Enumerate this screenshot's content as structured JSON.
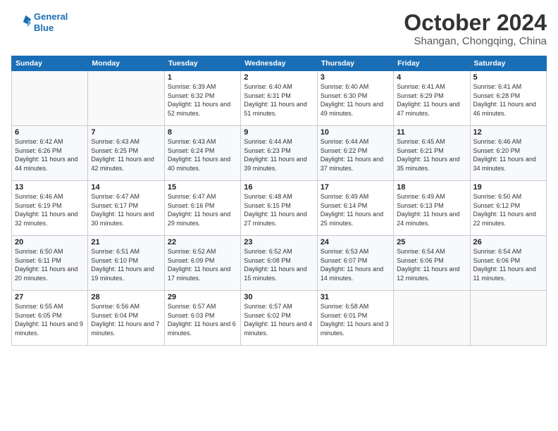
{
  "header": {
    "logo_line1": "General",
    "logo_line2": "Blue",
    "month": "October 2024",
    "location": "Shangan, Chongqing, China"
  },
  "weekdays": [
    "Sunday",
    "Monday",
    "Tuesday",
    "Wednesday",
    "Thursday",
    "Friday",
    "Saturday"
  ],
  "weeks": [
    [
      {
        "day": "",
        "sunrise": "",
        "sunset": "",
        "daylight": ""
      },
      {
        "day": "",
        "sunrise": "",
        "sunset": "",
        "daylight": ""
      },
      {
        "day": "1",
        "sunrise": "Sunrise: 6:39 AM",
        "sunset": "Sunset: 6:32 PM",
        "daylight": "Daylight: 11 hours and 52 minutes."
      },
      {
        "day": "2",
        "sunrise": "Sunrise: 6:40 AM",
        "sunset": "Sunset: 6:31 PM",
        "daylight": "Daylight: 11 hours and 51 minutes."
      },
      {
        "day": "3",
        "sunrise": "Sunrise: 6:40 AM",
        "sunset": "Sunset: 6:30 PM",
        "daylight": "Daylight: 11 hours and 49 minutes."
      },
      {
        "day": "4",
        "sunrise": "Sunrise: 6:41 AM",
        "sunset": "Sunset: 6:29 PM",
        "daylight": "Daylight: 11 hours and 47 minutes."
      },
      {
        "day": "5",
        "sunrise": "Sunrise: 6:41 AM",
        "sunset": "Sunset: 6:28 PM",
        "daylight": "Daylight: 11 hours and 46 minutes."
      }
    ],
    [
      {
        "day": "6",
        "sunrise": "Sunrise: 6:42 AM",
        "sunset": "Sunset: 6:26 PM",
        "daylight": "Daylight: 11 hours and 44 minutes."
      },
      {
        "day": "7",
        "sunrise": "Sunrise: 6:43 AM",
        "sunset": "Sunset: 6:25 PM",
        "daylight": "Daylight: 11 hours and 42 minutes."
      },
      {
        "day": "8",
        "sunrise": "Sunrise: 6:43 AM",
        "sunset": "Sunset: 6:24 PM",
        "daylight": "Daylight: 11 hours and 40 minutes."
      },
      {
        "day": "9",
        "sunrise": "Sunrise: 6:44 AM",
        "sunset": "Sunset: 6:23 PM",
        "daylight": "Daylight: 11 hours and 39 minutes."
      },
      {
        "day": "10",
        "sunrise": "Sunrise: 6:44 AM",
        "sunset": "Sunset: 6:22 PM",
        "daylight": "Daylight: 11 hours and 37 minutes."
      },
      {
        "day": "11",
        "sunrise": "Sunrise: 6:45 AM",
        "sunset": "Sunset: 6:21 PM",
        "daylight": "Daylight: 11 hours and 35 minutes."
      },
      {
        "day": "12",
        "sunrise": "Sunrise: 6:46 AM",
        "sunset": "Sunset: 6:20 PM",
        "daylight": "Daylight: 11 hours and 34 minutes."
      }
    ],
    [
      {
        "day": "13",
        "sunrise": "Sunrise: 6:46 AM",
        "sunset": "Sunset: 6:19 PM",
        "daylight": "Daylight: 11 hours and 32 minutes."
      },
      {
        "day": "14",
        "sunrise": "Sunrise: 6:47 AM",
        "sunset": "Sunset: 6:17 PM",
        "daylight": "Daylight: 11 hours and 30 minutes."
      },
      {
        "day": "15",
        "sunrise": "Sunrise: 6:47 AM",
        "sunset": "Sunset: 6:16 PM",
        "daylight": "Daylight: 11 hours and 29 minutes."
      },
      {
        "day": "16",
        "sunrise": "Sunrise: 6:48 AM",
        "sunset": "Sunset: 6:15 PM",
        "daylight": "Daylight: 11 hours and 27 minutes."
      },
      {
        "day": "17",
        "sunrise": "Sunrise: 6:49 AM",
        "sunset": "Sunset: 6:14 PM",
        "daylight": "Daylight: 11 hours and 25 minutes."
      },
      {
        "day": "18",
        "sunrise": "Sunrise: 6:49 AM",
        "sunset": "Sunset: 6:13 PM",
        "daylight": "Daylight: 11 hours and 24 minutes."
      },
      {
        "day": "19",
        "sunrise": "Sunrise: 6:50 AM",
        "sunset": "Sunset: 6:12 PM",
        "daylight": "Daylight: 11 hours and 22 minutes."
      }
    ],
    [
      {
        "day": "20",
        "sunrise": "Sunrise: 6:50 AM",
        "sunset": "Sunset: 6:11 PM",
        "daylight": "Daylight: 11 hours and 20 minutes."
      },
      {
        "day": "21",
        "sunrise": "Sunrise: 6:51 AM",
        "sunset": "Sunset: 6:10 PM",
        "daylight": "Daylight: 11 hours and 19 minutes."
      },
      {
        "day": "22",
        "sunrise": "Sunrise: 6:52 AM",
        "sunset": "Sunset: 6:09 PM",
        "daylight": "Daylight: 11 hours and 17 minutes."
      },
      {
        "day": "23",
        "sunrise": "Sunrise: 6:52 AM",
        "sunset": "Sunset: 6:08 PM",
        "daylight": "Daylight: 11 hours and 15 minutes."
      },
      {
        "day": "24",
        "sunrise": "Sunrise: 6:53 AM",
        "sunset": "Sunset: 6:07 PM",
        "daylight": "Daylight: 11 hours and 14 minutes."
      },
      {
        "day": "25",
        "sunrise": "Sunrise: 6:54 AM",
        "sunset": "Sunset: 6:06 PM",
        "daylight": "Daylight: 11 hours and 12 minutes."
      },
      {
        "day": "26",
        "sunrise": "Sunrise: 6:54 AM",
        "sunset": "Sunset: 6:06 PM",
        "daylight": "Daylight: 11 hours and 11 minutes."
      }
    ],
    [
      {
        "day": "27",
        "sunrise": "Sunrise: 6:55 AM",
        "sunset": "Sunset: 6:05 PM",
        "daylight": "Daylight: 11 hours and 9 minutes."
      },
      {
        "day": "28",
        "sunrise": "Sunrise: 6:56 AM",
        "sunset": "Sunset: 6:04 PM",
        "daylight": "Daylight: 11 hours and 7 minutes."
      },
      {
        "day": "29",
        "sunrise": "Sunrise: 6:57 AM",
        "sunset": "Sunset: 6:03 PM",
        "daylight": "Daylight: 11 hours and 6 minutes."
      },
      {
        "day": "30",
        "sunrise": "Sunrise: 6:57 AM",
        "sunset": "Sunset: 6:02 PM",
        "daylight": "Daylight: 11 hours and 4 minutes."
      },
      {
        "day": "31",
        "sunrise": "Sunrise: 6:58 AM",
        "sunset": "Sunset: 6:01 PM",
        "daylight": "Daylight: 11 hours and 3 minutes."
      },
      {
        "day": "",
        "sunrise": "",
        "sunset": "",
        "daylight": ""
      },
      {
        "day": "",
        "sunrise": "",
        "sunset": "",
        "daylight": ""
      }
    ]
  ]
}
